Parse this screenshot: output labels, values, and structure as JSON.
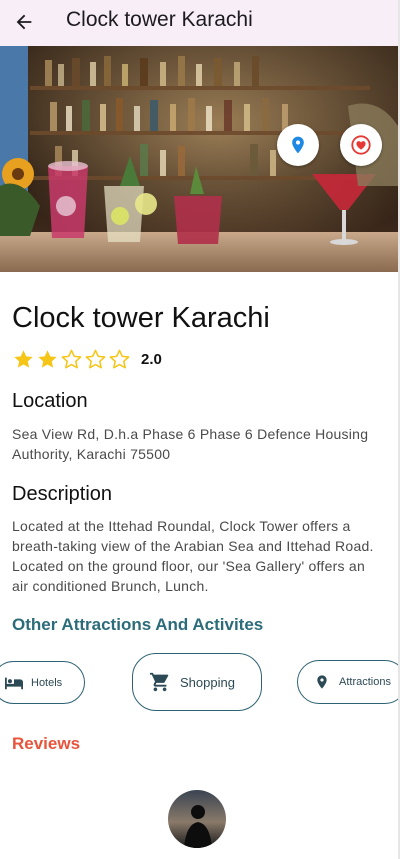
{
  "app_bar": {
    "title": "Clock tower Karachi"
  },
  "place": {
    "name": "Clock tower Karachi",
    "rating": 2.0,
    "rating_text": "2.0",
    "max_rating": 5
  },
  "location": {
    "heading": "Location",
    "address": "Sea View Rd, D.h.a Phase 6 Phase 6 Defence Housing Authority, Karachi 75500"
  },
  "description": {
    "heading": "Description",
    "text": "Located at the Ittehad Roundal, Clock Tower offers a breath-taking view of the Arabian Sea and Ittehad Road. Located on the ground floor, our 'Sea Gallery' offers an air conditioned Brunch, Lunch."
  },
  "attractions": {
    "heading": "Other Attractions And Activites",
    "chips": [
      {
        "label": "Hotels",
        "icon": "bed-icon"
      },
      {
        "label": "Shopping",
        "icon": "cart-icon"
      },
      {
        "label": "Attractions",
        "icon": "pin-icon"
      }
    ]
  },
  "reviews": {
    "heading": "Reviews"
  },
  "colors": {
    "app_bar_bg": "#f8eef8",
    "star": "#f5c518",
    "teal": "#2c6b7a",
    "reviews_red": "#e8543c",
    "pin_blue": "#1e88e5",
    "heart_red": "#e53935"
  }
}
